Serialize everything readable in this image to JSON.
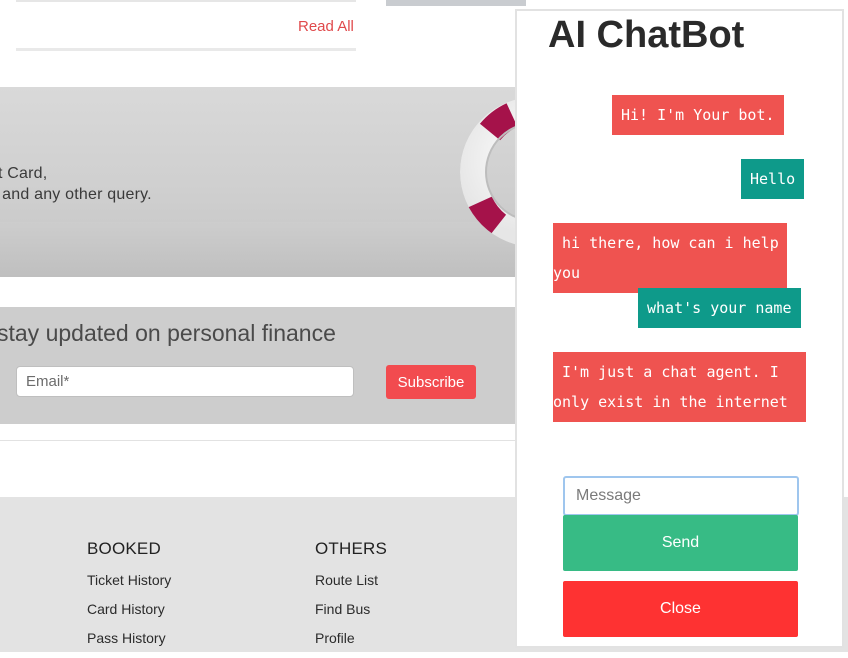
{
  "news": {
    "read_all": "Read All"
  },
  "banner": {
    "line1": "t Card,",
    "line2": "r and any other query."
  },
  "subscribe": {
    "title": "stay updated on personal finance",
    "email_placeholder": "Email*",
    "button": "Subscribe"
  },
  "footer": {
    "columns": [
      {
        "heading": "BOOKED",
        "links": [
          "Ticket History",
          "Card History",
          "Pass History"
        ]
      },
      {
        "heading": "OTHERS",
        "links": [
          "Route List",
          "Find Bus",
          "Profile"
        ]
      }
    ]
  },
  "chatbot": {
    "title": "AI ChatBot",
    "messages": [
      {
        "sender": "bot",
        "text": "Hi! I'm Your bot."
      },
      {
        "sender": "user",
        "text": "Hello"
      },
      {
        "sender": "bot",
        "text": "hi there, how can i help",
        "text2": "you"
      },
      {
        "sender": "user",
        "text": "what's your name"
      },
      {
        "sender": "bot",
        "text": "I'm just a chat agent. I",
        "text2": "only exist in the internet"
      }
    ],
    "input_placeholder": "Message",
    "send_label": "Send",
    "close_label": "Close"
  },
  "colors": {
    "bot_bubble": "#ef5350",
    "user_bubble": "#0e9a8a",
    "send": "#37bb85",
    "close": "#fe3232",
    "accent_red": "#e0494b"
  }
}
